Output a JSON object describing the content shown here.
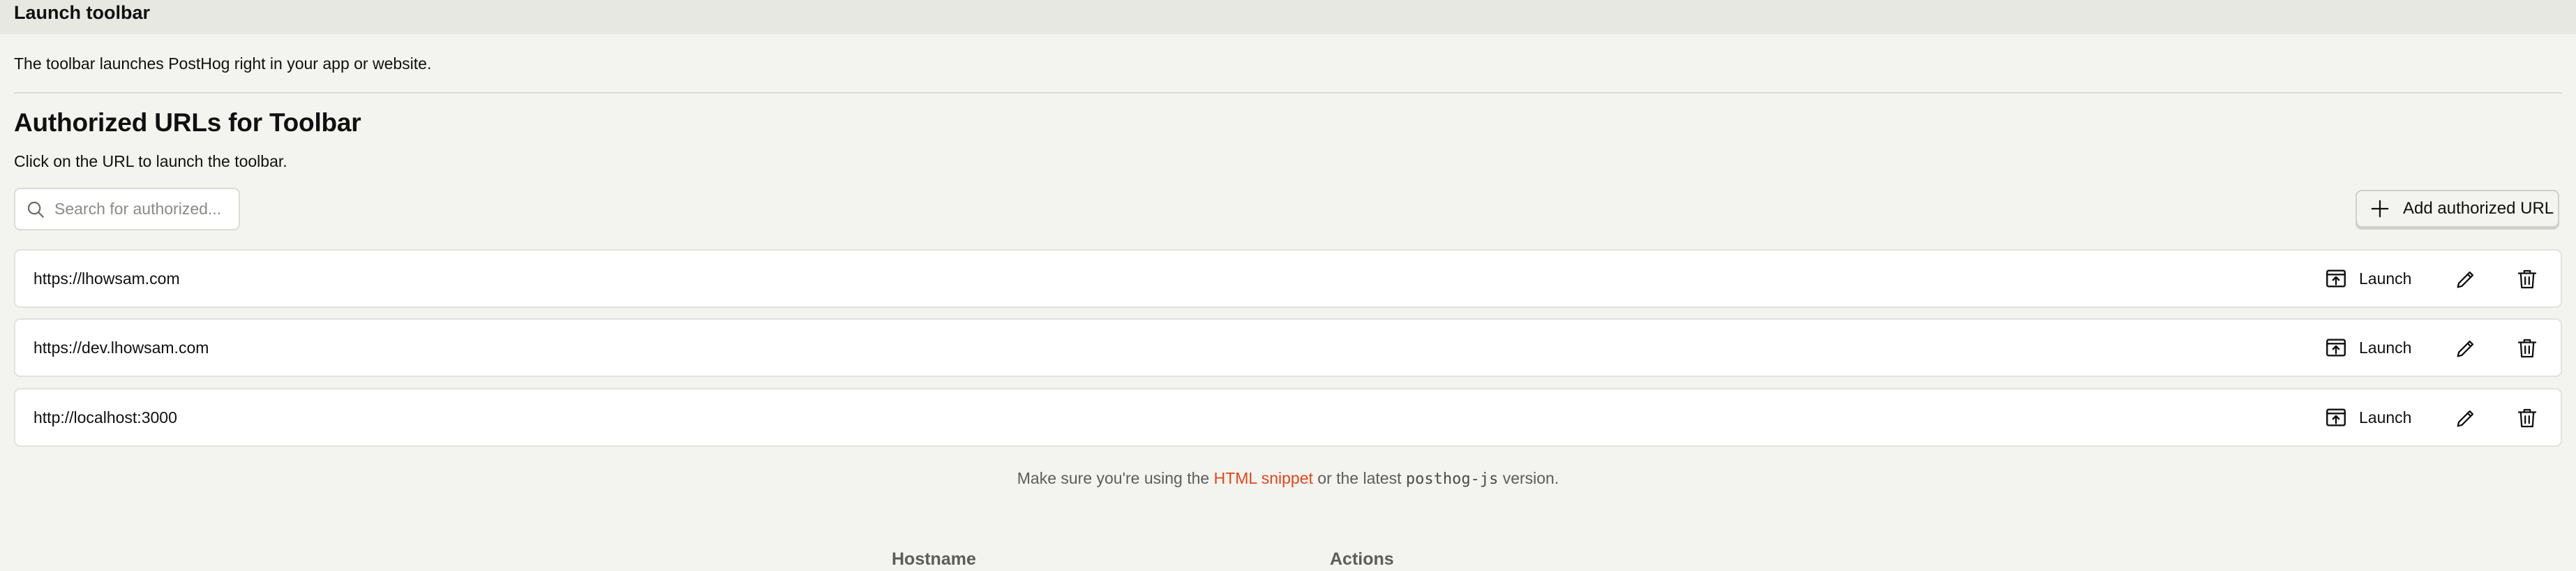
{
  "header": {
    "title": "Launch toolbar"
  },
  "description": "The toolbar launches PostHog right in your app or website.",
  "section": {
    "title": "Authorized URLs for Toolbar",
    "subtitle": "Click on the URL to launch the toolbar."
  },
  "search": {
    "placeholder": "Search for authorized..."
  },
  "add_button": {
    "label": "Add authorized URL"
  },
  "urls": [
    {
      "url": "https://lhowsam.com",
      "launch_label": "Launch"
    },
    {
      "url": "https://dev.lhowsam.com",
      "launch_label": "Launch"
    },
    {
      "url": "http://localhost:3000",
      "launch_label": "Launch"
    }
  ],
  "footnote": {
    "prefix": "Make sure you're using the",
    "link": "HTML snippet",
    "middle": "or the latest",
    "code": "posthog-js",
    "suffix": "version."
  },
  "table_headers": {
    "hostname": "Hostname",
    "actions": "Actions"
  },
  "colors": {
    "link": "#d94a1e",
    "background": "#f3f3ef",
    "header_bar": "#e8e8e3"
  }
}
